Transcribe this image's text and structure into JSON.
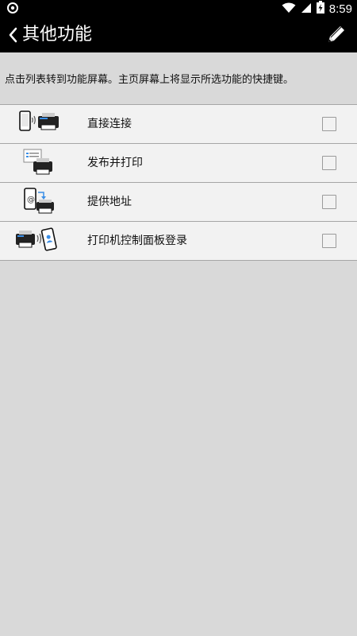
{
  "status_bar": {
    "time": "8:59",
    "icons": [
      "notification-icon",
      "wifi-icon",
      "signal-icon",
      "battery-charging-icon"
    ]
  },
  "app_bar": {
    "title": "其他功能",
    "back_icon": "chevron-left-icon",
    "edit_icon": "pencil-icon"
  },
  "description": "点击列表转到功能屏幕。主页屏幕上将显示所选功能的快捷键。",
  "list": {
    "items": [
      {
        "label": "直接连接",
        "icon": "phone-wireless-printer-icon",
        "checked": false
      },
      {
        "label": "发布并打印",
        "icon": "document-printer-icon",
        "checked": false
      },
      {
        "label": "提供地址",
        "icon": "email-address-printer-icon",
        "checked": false
      },
      {
        "label": "打印机控制面板登录",
        "icon": "printer-login-phone-icon",
        "checked": false
      }
    ]
  }
}
